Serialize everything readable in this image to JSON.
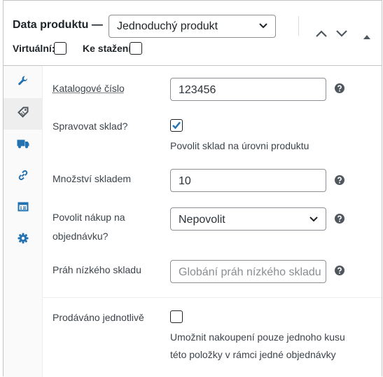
{
  "header": {
    "title": "Data produktu —",
    "product_type": "Jednoduchý produkt",
    "virtual_label": "Virtuální:",
    "downloadable_label": "Ke stažení:",
    "virtual_checked": false,
    "downloadable_checked": false
  },
  "sidebar": {
    "items": [
      {
        "icon": "wrench-icon",
        "active": false
      },
      {
        "icon": "tag-icon",
        "active": true
      },
      {
        "icon": "truck-icon",
        "active": false
      },
      {
        "icon": "link-icon",
        "active": false
      },
      {
        "icon": "table-icon",
        "active": false
      },
      {
        "icon": "gear-icon",
        "active": false
      }
    ]
  },
  "inventory": {
    "sku_label": "Katalogové číslo",
    "sku_value": "123456",
    "manage_stock_label": "Spravovat sklad?",
    "manage_stock_checked": true,
    "manage_stock_desc": "Povolit sklad na úrovni produktu",
    "quantity_label": "Množství skladem",
    "quantity_value": "10",
    "backorders_label_1": "Povolit nákup na",
    "backorders_label_2": "objednávku?",
    "backorders_value": "Nepovolit",
    "low_stock_label": "Práh nízkého skladu",
    "low_stock_placeholder": "Globání práh nízkého skladu",
    "sold_individually_label": "Prodáváno jednotlivě",
    "sold_individually_checked": false,
    "sold_individually_desc_1": "Umožnit nakoupení pouze jednoho kusu",
    "sold_individually_desc_2": "této položky v rámci jedné objednávky"
  },
  "colors": {
    "accent": "#2271b1",
    "border": "#8c8f94",
    "help": "#50575e"
  }
}
